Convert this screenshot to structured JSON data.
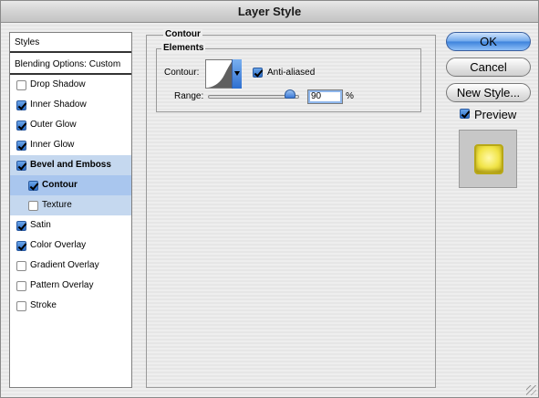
{
  "window": {
    "title": "Layer Style"
  },
  "style_list": {
    "header": "Styles",
    "blending_options": "Blending Options: Custom",
    "items": [
      {
        "label": "Drop Shadow",
        "checked": false
      },
      {
        "label": "Inner Shadow",
        "checked": true
      },
      {
        "label": "Outer Glow",
        "checked": true
      },
      {
        "label": "Inner Glow",
        "checked": true
      },
      {
        "label": "Bevel and Emboss",
        "checked": true
      },
      {
        "label": "Contour",
        "checked": true
      },
      {
        "label": "Texture",
        "checked": false
      },
      {
        "label": "Satin",
        "checked": true
      },
      {
        "label": "Color Overlay",
        "checked": true
      },
      {
        "label": "Gradient Overlay",
        "checked": false
      },
      {
        "label": "Pattern Overlay",
        "checked": false
      },
      {
        "label": "Stroke",
        "checked": false
      }
    ]
  },
  "contour_panel": {
    "title": "Contour",
    "group_title": "Elements",
    "contour_label": "Contour:",
    "anti_aliased_label": "Anti-aliased",
    "anti_aliased_checked": true,
    "range_label": "Range:",
    "range_value": "90",
    "range_unit": "%",
    "range_fraction": 0.9
  },
  "buttons": {
    "ok": "OK",
    "cancel": "Cancel",
    "new_style": "New Style..."
  },
  "preview": {
    "label": "Preview",
    "checked": true
  },
  "colors": {
    "selection": "#c5d8ef",
    "sub_selection": "#a9c6ee",
    "accent_blue": "#3c82dc",
    "preview_swatch": "#f1e447"
  }
}
